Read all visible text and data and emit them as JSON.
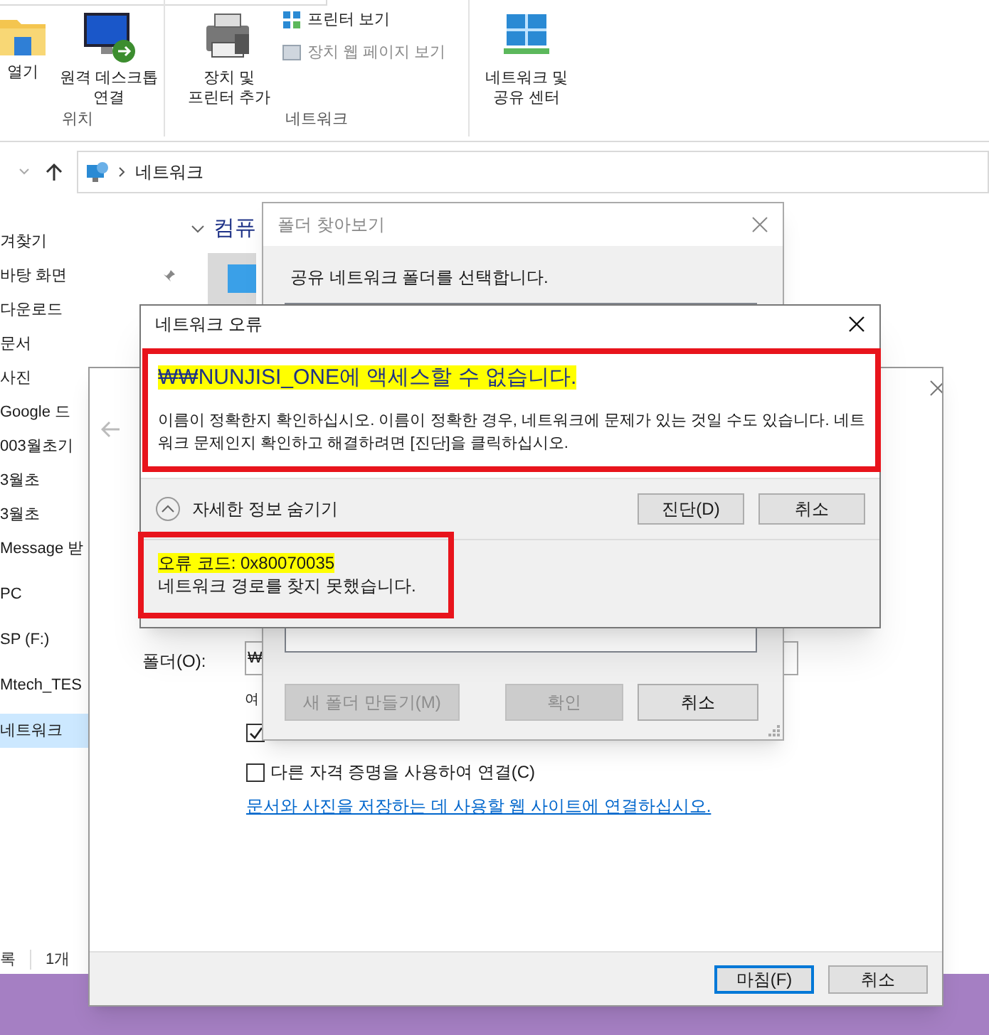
{
  "explorer": {
    "ribbon": {
      "groups": [
        {
          "label": "위치",
          "buttons": [
            {
              "label": "열기"
            },
            {
              "label": "원격 데스크톱\n연결"
            }
          ]
        },
        {
          "label": "네트워크",
          "buttons": [
            {
              "label": "장치 및\n프린터 추가"
            }
          ],
          "small_buttons": [
            {
              "label": "프린터 보기",
              "disabled": false
            },
            {
              "label": "장치 웹 페이지 보기",
              "disabled": true
            }
          ]
        },
        {
          "buttons": [
            {
              "label": "네트워크 및\n공유 센터"
            }
          ]
        }
      ]
    },
    "address_bar": {
      "path": "네트워크"
    },
    "sidebar": {
      "items": [
        {
          "label": "겨찾기",
          "selected": false,
          "pinned": false
        },
        {
          "label": "바탕 화면",
          "selected": false,
          "pinned": true
        },
        {
          "label": "다운로드",
          "selected": false,
          "pinned": false
        },
        {
          "label": "문서",
          "selected": false,
          "pinned": false
        },
        {
          "label": "사진",
          "selected": false,
          "pinned": false
        },
        {
          "label": "Google 드",
          "selected": false,
          "pinned": false
        },
        {
          "label": "003월초기",
          "selected": false,
          "pinned": false
        },
        {
          "label": "3월초",
          "selected": false,
          "pinned": false
        },
        {
          "label": "3월초",
          "selected": false,
          "pinned": false
        },
        {
          "label": "Message 받",
          "selected": false,
          "pinned": false
        },
        {
          "label": "PC",
          "selected": false,
          "pinned": false
        },
        {
          "label": "SP (F:)",
          "selected": false,
          "pinned": false
        },
        {
          "label": "Mtech_TES",
          "selected": false,
          "pinned": false
        },
        {
          "label": "네트워크",
          "selected": true,
          "pinned": false
        }
      ]
    },
    "content": {
      "group_header": "컴퓨"
    },
    "status_bar": [
      "록",
      "1개"
    ]
  },
  "map_drive_wizard": {
    "folder_label": "폴더(O):",
    "folder_value": "₩",
    "hint": "여",
    "checkboxes": [
      {
        "checked": true
      },
      {
        "label": "다른 자격 증명을 사용하여 연결(C)",
        "checked": false
      }
    ],
    "link": "문서와 사진을 저장하는 데 사용할 웹 사이트에 연결하십시오.",
    "buttons": [
      {
        "label": "마침(F)",
        "focused": true
      },
      {
        "label": "취소",
        "focused": false
      }
    ]
  },
  "browse_dialog": {
    "title": "폴더 찾아보기",
    "prompt": "공유 네트워크 폴더를 선택합니다.",
    "buttons": [
      {
        "label": "새 폴더 만들기(M)",
        "disabled": true
      },
      {
        "label": "확인",
        "disabled": true
      },
      {
        "label": "취소",
        "disabled": false
      }
    ]
  },
  "error_dialog": {
    "title": "네트워크 오류",
    "heading": "₩₩NUNJISI_ONE에 액세스할 수 없습니다.",
    "heading_highlighted": true,
    "message": "이름이 정확한지 확인하십시오. 이름이 정확한 경우, 네트워크에 문제가 있는 것일 수도 있습니다. 네트워크 문제인지 확인하고 해결하려면 [진단]을 클릭하십시오.",
    "details_toggle": {
      "label": "자세한 정보 숨기기",
      "expanded": true
    },
    "buttons": [
      "진단(D)",
      "취소"
    ],
    "error_code": "오류 코드: 0x80070035",
    "error_code_highlighted": true,
    "detail": "네트워크 경로를 찾지 못했습니다."
  }
}
